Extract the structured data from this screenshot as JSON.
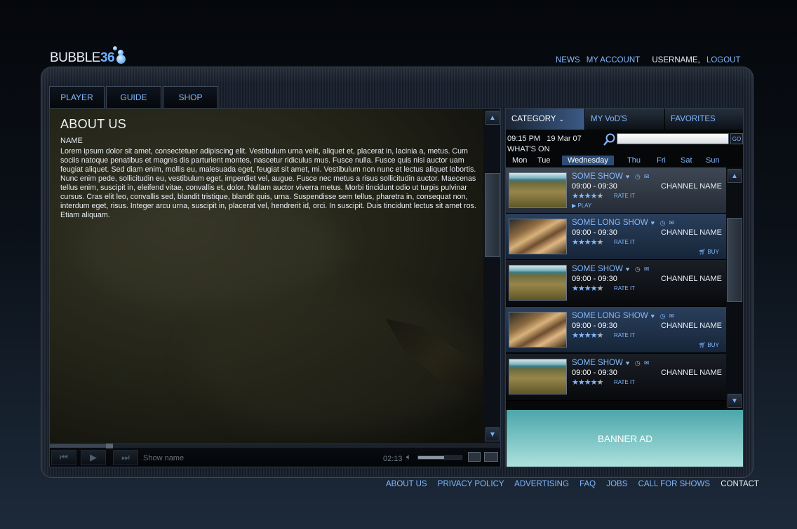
{
  "brand": {
    "logo_text": "BUBBLE",
    "logo_number": "36"
  },
  "topnav": {
    "news": "NEWS",
    "my_account": "MY ACCOUNT",
    "username": "USERNAME,",
    "logout": "LOGOUT"
  },
  "tabs": [
    "PLAYER",
    "GUIDE",
    "SHOP"
  ],
  "about": {
    "title": "ABOUT US",
    "name": "NAME",
    "body": "Lorem ipsum dolor sit amet, consectetuer adipiscing elit. Vestibulum urna velit, aliquet et, placerat in, lacinia a, metus. Cum sociis natoque penatibus et magnis dis parturient montes, nascetur ridiculus mus. Fusce nulla. Fusce quis nisi auctor uam feugiat aliquet. Sed diam enim, mollis eu, malesuada eget, feugiat sit amet, mi. Vestibulum non nunc et lectus aliquet lobortis. Nunc enim pede, sollicitudin eu, vestibulum eget, imperdiet vel, augue. Fusce nec metus a risus sollicitudin auctor. Maecenas tellus enim, suscipit in, eleifend vitae, convallis et, dolor. Nullam auctor viverra metus. Morbi tincidunt odio ut turpis pulvinar cursus. Cras elit leo, convallis sed, blandit tristique, blandit quis, urna. Suspendisse sem tellus, pharetra in, consequat non, interdum eget, risus. Integer arcu urna, suscipit in, placerat vel, hendrerit id, orci. In suscipit. Duis tincidunt lectus sit amet ros. Etiam aliquam."
  },
  "player": {
    "show_name": "Show name",
    "time": "02:13",
    "volume_level": 0.6,
    "progress_level": 0.13
  },
  "sidebar": {
    "tabs": {
      "category": "CATEGORY",
      "myvods": "MY VoD'S",
      "favorites": "FAVORITES"
    },
    "datetime": "09:15 PM   19 Mar 07",
    "search_placeholder": "",
    "go": "GO",
    "whats_on": "WHAT'S ON",
    "days": [
      "Mon",
      "Tue",
      "Wednesday",
      "Thu",
      "Fri",
      "Sat",
      "Sun"
    ],
    "selected_day": "Wednesday",
    "items": [
      {
        "title": "SOME SHOW",
        "time": "09:00 - 09:30",
        "channel": "CHANNEL NAME",
        "rating": 4,
        "rate_label": "RATE IT",
        "action": "PLAY"
      },
      {
        "title": "SOME LONG SHOW",
        "time": "09:00 - 09:30",
        "channel": "CHANNEL NAME",
        "rating": 4,
        "rate_label": "RATE IT",
        "action": "BUY"
      },
      {
        "title": "SOME SHOW",
        "time": "09:00 - 09:30",
        "channel": "CHANNEL NAME",
        "rating": 4,
        "rate_label": "RATE IT",
        "action": ""
      },
      {
        "title": "SOME LONG SHOW",
        "time": "09:00 - 09:30",
        "channel": "CHANNEL NAME",
        "rating": 4,
        "rate_label": "RATE IT",
        "action": "BUY"
      },
      {
        "title": "SOME SHOW",
        "time": "09:00 - 09:30",
        "channel": "CHANNEL NAME",
        "rating": 4,
        "rate_label": "RATE IT",
        "action": ""
      }
    ],
    "banner": "BANNER AD"
  },
  "footer": {
    "links": [
      "ABOUT US",
      "PRIVACY POLICY",
      "ADVERTISING",
      "FAQ",
      "JOBS",
      "CALL FOR SHOWS"
    ],
    "contact": "CONTACT"
  },
  "colors": {
    "accent": "#82b8ff",
    "background": "#0b1119",
    "banner": "#6fc3c0"
  }
}
